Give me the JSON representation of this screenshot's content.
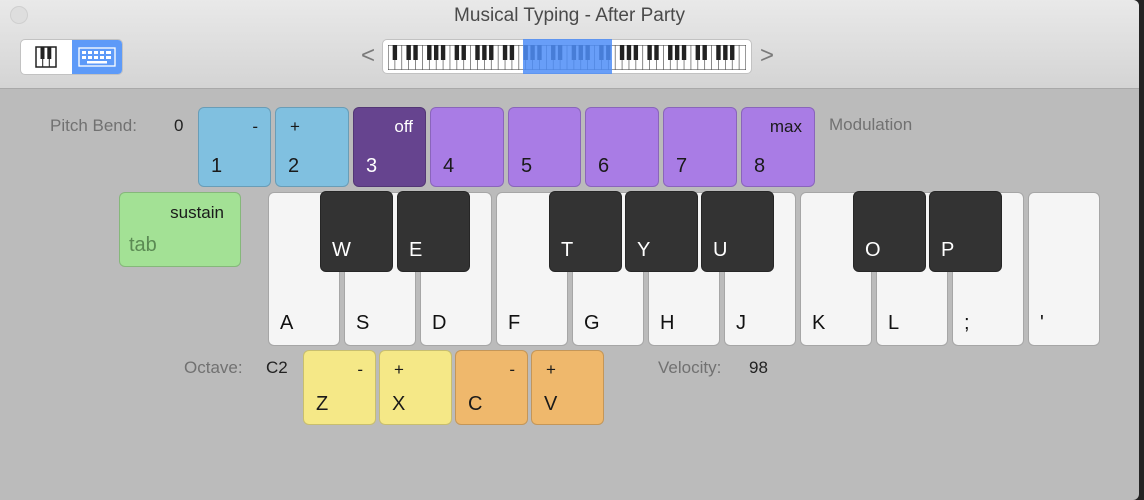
{
  "window": {
    "title": "Musical Typing - After Party"
  },
  "toolbar": {
    "view_modes": [
      {
        "name": "piano-view",
        "icon": "piano-keys-icon",
        "selected": false
      },
      {
        "name": "musical-typing-view",
        "icon": "keyboard-icon",
        "selected": true
      }
    ],
    "nav_prev": "<",
    "nav_next": ">",
    "range_selector_icon": "mini-piano-keyboard-icon"
  },
  "pitch_bend": {
    "label": "Pitch Bend:",
    "value": "0"
  },
  "modulation": {
    "label": "Modulation"
  },
  "number_keys": [
    {
      "key": "1",
      "function": "-",
      "group": "pitch-bend"
    },
    {
      "key": "2",
      "function": "+",
      "group": "pitch-bend"
    },
    {
      "key": "3",
      "function": "off",
      "group": "modulation"
    },
    {
      "key": "4",
      "function": "",
      "group": "modulation"
    },
    {
      "key": "5",
      "function": "",
      "group": "modulation"
    },
    {
      "key": "6",
      "function": "",
      "group": "modulation"
    },
    {
      "key": "7",
      "function": "",
      "group": "modulation"
    },
    {
      "key": "8",
      "function": "max",
      "group": "modulation"
    }
  ],
  "sustain_key": {
    "function": "sustain",
    "key": "tab"
  },
  "white_keys": [
    "A",
    "S",
    "D",
    "F",
    "G",
    "H",
    "J",
    "K",
    "L",
    ";",
    "'"
  ],
  "black_keys": [
    "W",
    "E",
    "T",
    "Y",
    "U",
    "O",
    "P"
  ],
  "octave": {
    "label": "Octave:",
    "value": "C2",
    "keys": [
      {
        "key": "Z",
        "function": "-"
      },
      {
        "key": "X",
        "function": "+"
      }
    ]
  },
  "velocity": {
    "label": "Velocity:",
    "value": "98",
    "keys": [
      {
        "key": "C",
        "function": "-"
      },
      {
        "key": "V",
        "function": "+"
      }
    ]
  },
  "colors": {
    "pitch_bend_keys": "#80c0e0",
    "modulation_off_key": "#66448f",
    "modulation_keys": "#a97ce5",
    "sustain_key": "#a3e195",
    "octave_keys": "#f5e887",
    "velocity_keys": "#efb86c",
    "selected_accent": "#5d9af8"
  }
}
